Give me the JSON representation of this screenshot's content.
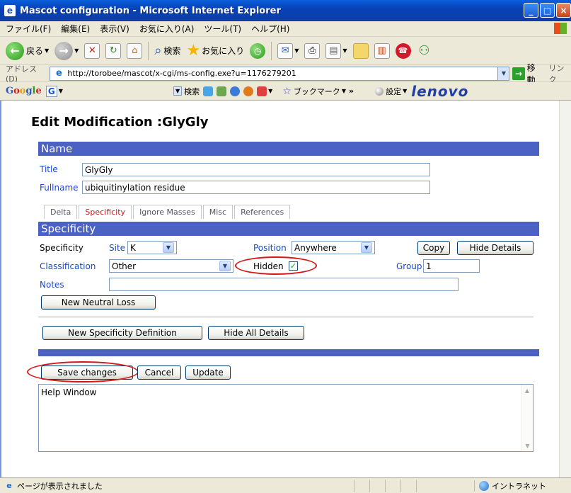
{
  "window": {
    "title": "Mascot configuration - Microsoft Internet Explorer"
  },
  "menu": [
    "ファイル(F)",
    "編集(E)",
    "表示(V)",
    "お気に入り(A)",
    "ツール(T)",
    "ヘルプ(H)"
  ],
  "toolbar": {
    "back": "戻る",
    "search": "検索",
    "favorites": "お気に入り"
  },
  "address": {
    "label": "アドレス(D)",
    "url": "http://torobee/mascot/x-cgi/ms-config.exe?u=1176279201",
    "go": "移動",
    "links": "リンク"
  },
  "google": {
    "logo": "Google",
    "search": "検索",
    "bookmark": "ブックマーク",
    "chevron": "»",
    "settings": "設定",
    "brand": "lenovo"
  },
  "page": {
    "title": "Edit Modification :GlyGly",
    "name_section": "Name",
    "title_label": "Title",
    "title_value": "GlyGly",
    "fullname_label": "Fullname",
    "fullname_value": "ubiquitinylation residue",
    "tabs": [
      "Delta",
      "Specificity",
      "Ignore Masses",
      "Misc",
      "References"
    ],
    "specificity_section": "Specificity",
    "specificity_label": "Specificity",
    "site_label": "Site",
    "site_value": "K",
    "position_label": "Position",
    "position_value": "Anywhere",
    "copy_button": "Copy",
    "hide_details_button": "Hide Details",
    "classification_label": "Classification",
    "classification_value": "Other",
    "hidden_label": "Hidden",
    "hidden_checked": true,
    "group_label": "Group",
    "group_value": "1",
    "notes_label": "Notes",
    "notes_value": "",
    "new_neutral_loss_button": "New Neutral Loss",
    "new_specificity_button": "New Specificity Definition",
    "hide_all_details_button": "Hide All Details",
    "save_button": "Save changes",
    "cancel_button": "Cancel",
    "update_button": "Update",
    "help_text": "Help Window"
  },
  "status": {
    "text": "ページが表示されました",
    "zone": "イントラネット"
  },
  "colors": {
    "section_bar": "#4b61c4",
    "label_blue": "#1a47d8",
    "annotation_red": "#d81818"
  }
}
